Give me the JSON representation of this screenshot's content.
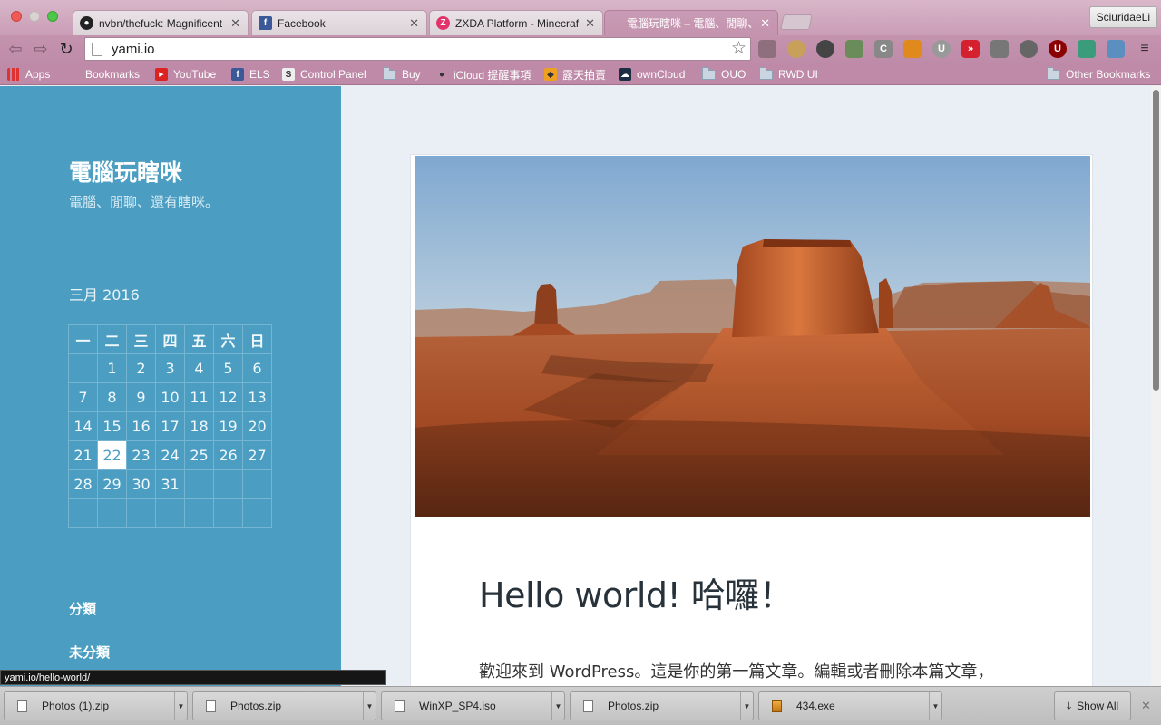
{
  "tabs": [
    {
      "title": "nvbn/thefuck: Magnificent",
      "icon": "github-icon"
    },
    {
      "title": "Facebook",
      "icon": "facebook-icon"
    },
    {
      "title": "ZXDA Platform - Minecraft",
      "icon": "zxda-icon"
    },
    {
      "title": "電腦玩瞎咪 – 電腦、閒聊、還",
      "icon": "page-icon",
      "active": true
    }
  ],
  "profile_name": "SciuridaeLi",
  "address_bar": {
    "url": "yami.io"
  },
  "bookmarks": [
    {
      "label": "Apps",
      "icon": "apps-grid-icon"
    },
    {
      "label": "Bookmarks",
      "icon": "bookmark-icon"
    },
    {
      "label": "YouTube",
      "icon": "youtube-icon"
    },
    {
      "label": "ELS",
      "icon": "facebook-icon"
    },
    {
      "label": "Control Panel",
      "icon": "s-logo-icon"
    },
    {
      "label": "Buy",
      "icon": "folder-icon"
    },
    {
      "label": "iCloud 提醒事項",
      "icon": "apple-icon"
    },
    {
      "label": "露天拍賣",
      "icon": "ruten-icon"
    },
    {
      "label": "ownCloud",
      "icon": "cloud-icon"
    },
    {
      "label": "OUO",
      "icon": "folder-icon"
    },
    {
      "label": "RWD UI",
      "icon": "folder-icon"
    },
    {
      "label": "Other Bookmarks",
      "icon": "folder-icon"
    }
  ],
  "site": {
    "title": "電腦玩瞎咪",
    "description": "電腦、閒聊、還有瞎咪。"
  },
  "calendar": {
    "caption": "三月 2016",
    "weekdays": [
      "一",
      "二",
      "三",
      "四",
      "五",
      "六",
      "日"
    ],
    "weeks": [
      [
        "",
        "1",
        "2",
        "3",
        "4",
        "5",
        "6"
      ],
      [
        "7",
        "8",
        "9",
        "10",
        "11",
        "12",
        "13"
      ],
      [
        "14",
        "15",
        "16",
        "17",
        "18",
        "19",
        "20"
      ],
      [
        "21",
        "22",
        "23",
        "24",
        "25",
        "26",
        "27"
      ],
      [
        "28",
        "29",
        "30",
        "31",
        "",
        "",
        ""
      ],
      [
        "",
        "",
        "",
        "",
        "",
        "",
        ""
      ]
    ],
    "today": "22"
  },
  "widgets": {
    "categories_title": "分類",
    "category_item": "未分類"
  },
  "post": {
    "title": "Hello world! 哈囉！",
    "excerpt": "歡迎來到 WordPress。這是你的第一篇文章。編輯或者刪除本篇文章，"
  },
  "status_url": "yami.io/hello-world/",
  "downloads": [
    {
      "name": "Photos (1).zip",
      "type": "zip"
    },
    {
      "name": "Photos.zip",
      "type": "zip"
    },
    {
      "name": "WinXP_SP4.iso",
      "type": "iso"
    },
    {
      "name": "Photos.zip",
      "type": "zip"
    },
    {
      "name": "434.exe",
      "type": "exe"
    }
  ],
  "show_all_label": "Show All"
}
